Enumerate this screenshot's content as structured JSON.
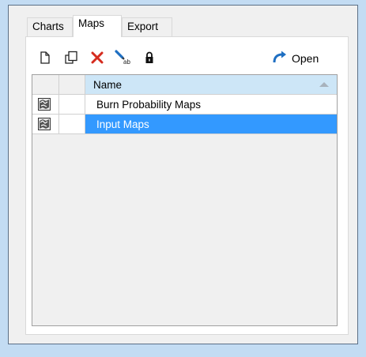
{
  "tabs": [
    {
      "label": "Charts",
      "active": false
    },
    {
      "label": "Maps",
      "active": true
    },
    {
      "label": "Export",
      "active": false
    }
  ],
  "toolbar": {
    "icons": [
      "new-document-icon",
      "copy-icon",
      "delete-icon",
      "rename-icon",
      "lock-icon"
    ],
    "open_label": "Open",
    "open_icon": "redo-arrow-icon",
    "delete_color": "#d52b1e",
    "accent_color": "#1f6fc2"
  },
  "grid": {
    "columns": {
      "name_header": "Name"
    },
    "rows": [
      {
        "icon": "map-icon",
        "name": "Burn Probability Maps",
        "selected": false
      },
      {
        "icon": "map-icon",
        "name": "Input Maps",
        "selected": true
      }
    ],
    "selection_color": "#3399ff",
    "header_color": "#cde6f7"
  }
}
